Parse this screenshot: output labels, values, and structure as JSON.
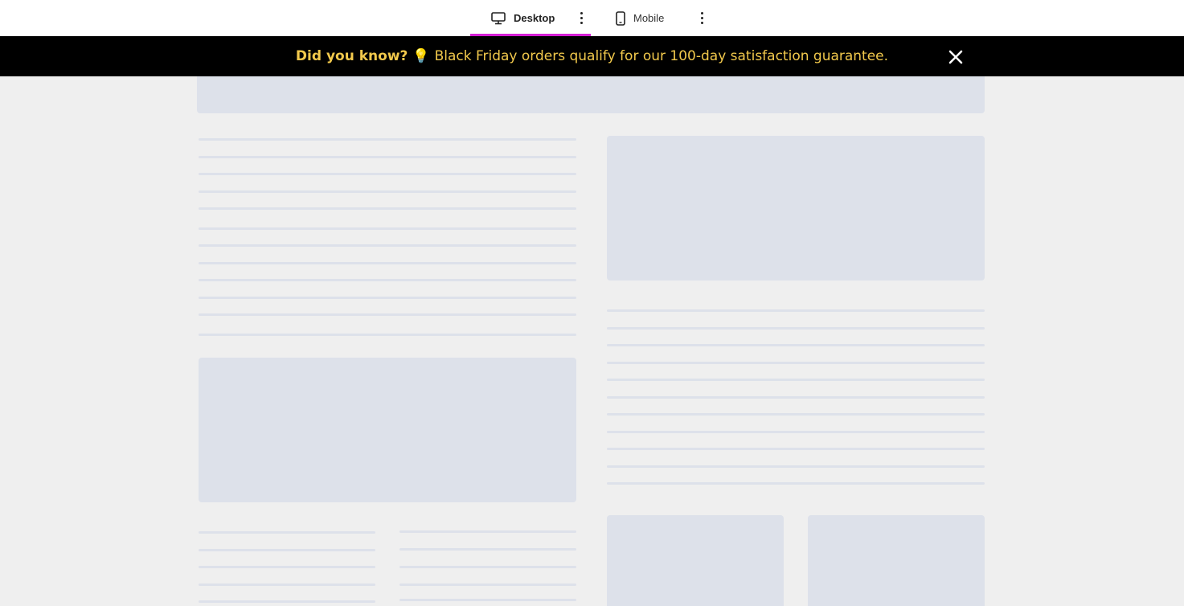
{
  "tabs": [
    {
      "label": "Desktop",
      "icon": "monitor-icon",
      "active": true
    },
    {
      "label": "Mobile",
      "icon": "phone-icon",
      "active": false
    }
  ],
  "banner": {
    "lead": "Did you know?",
    "emoji": "💡",
    "message": "Black Friday orders qualify for our 100-day satisfaction guarantee.",
    "close_icon": "close-icon"
  },
  "colors": {
    "active_tab": "#d61fd6",
    "banner_bg": "#000000",
    "banner_text": "#f2c94c",
    "skeleton": "#dde1ea",
    "page_bg": "#efefef"
  }
}
